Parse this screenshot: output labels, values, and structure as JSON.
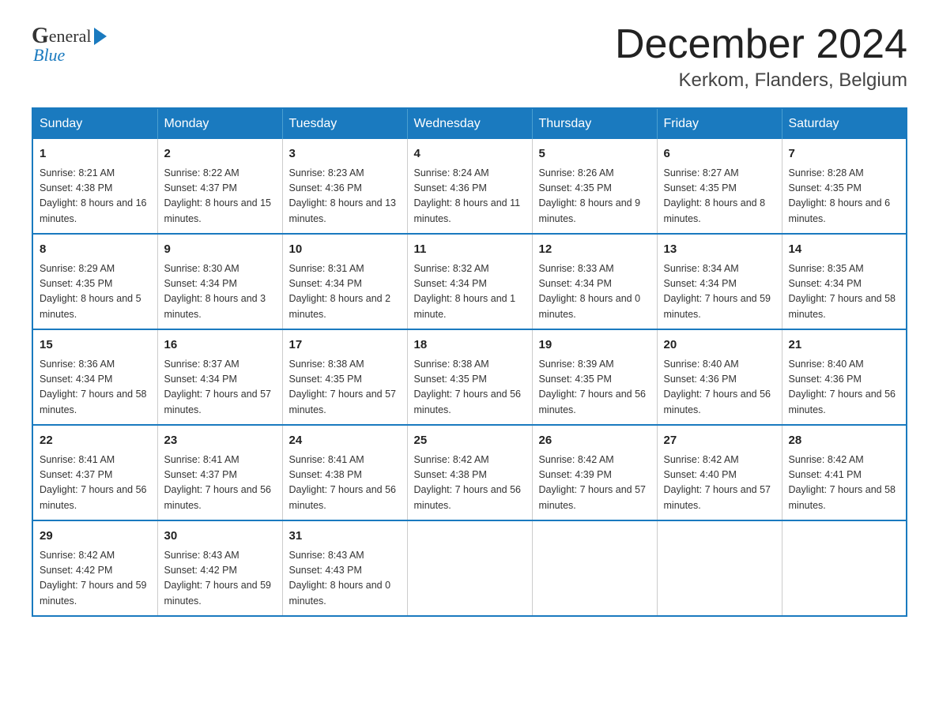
{
  "header": {
    "logo_general": "General",
    "logo_blue": "Blue",
    "month_title": "December 2024",
    "location": "Kerkom, Flanders, Belgium"
  },
  "days_of_week": [
    "Sunday",
    "Monday",
    "Tuesday",
    "Wednesday",
    "Thursday",
    "Friday",
    "Saturday"
  ],
  "weeks": [
    [
      {
        "day": "1",
        "sunrise": "Sunrise: 8:21 AM",
        "sunset": "Sunset: 4:38 PM",
        "daylight": "Daylight: 8 hours and 16 minutes."
      },
      {
        "day": "2",
        "sunrise": "Sunrise: 8:22 AM",
        "sunset": "Sunset: 4:37 PM",
        "daylight": "Daylight: 8 hours and 15 minutes."
      },
      {
        "day": "3",
        "sunrise": "Sunrise: 8:23 AM",
        "sunset": "Sunset: 4:36 PM",
        "daylight": "Daylight: 8 hours and 13 minutes."
      },
      {
        "day": "4",
        "sunrise": "Sunrise: 8:24 AM",
        "sunset": "Sunset: 4:36 PM",
        "daylight": "Daylight: 8 hours and 11 minutes."
      },
      {
        "day": "5",
        "sunrise": "Sunrise: 8:26 AM",
        "sunset": "Sunset: 4:35 PM",
        "daylight": "Daylight: 8 hours and 9 minutes."
      },
      {
        "day": "6",
        "sunrise": "Sunrise: 8:27 AM",
        "sunset": "Sunset: 4:35 PM",
        "daylight": "Daylight: 8 hours and 8 minutes."
      },
      {
        "day": "7",
        "sunrise": "Sunrise: 8:28 AM",
        "sunset": "Sunset: 4:35 PM",
        "daylight": "Daylight: 8 hours and 6 minutes."
      }
    ],
    [
      {
        "day": "8",
        "sunrise": "Sunrise: 8:29 AM",
        "sunset": "Sunset: 4:35 PM",
        "daylight": "Daylight: 8 hours and 5 minutes."
      },
      {
        "day": "9",
        "sunrise": "Sunrise: 8:30 AM",
        "sunset": "Sunset: 4:34 PM",
        "daylight": "Daylight: 8 hours and 3 minutes."
      },
      {
        "day": "10",
        "sunrise": "Sunrise: 8:31 AM",
        "sunset": "Sunset: 4:34 PM",
        "daylight": "Daylight: 8 hours and 2 minutes."
      },
      {
        "day": "11",
        "sunrise": "Sunrise: 8:32 AM",
        "sunset": "Sunset: 4:34 PM",
        "daylight": "Daylight: 8 hours and 1 minute."
      },
      {
        "day": "12",
        "sunrise": "Sunrise: 8:33 AM",
        "sunset": "Sunset: 4:34 PM",
        "daylight": "Daylight: 8 hours and 0 minutes."
      },
      {
        "day": "13",
        "sunrise": "Sunrise: 8:34 AM",
        "sunset": "Sunset: 4:34 PM",
        "daylight": "Daylight: 7 hours and 59 minutes."
      },
      {
        "day": "14",
        "sunrise": "Sunrise: 8:35 AM",
        "sunset": "Sunset: 4:34 PM",
        "daylight": "Daylight: 7 hours and 58 minutes."
      }
    ],
    [
      {
        "day": "15",
        "sunrise": "Sunrise: 8:36 AM",
        "sunset": "Sunset: 4:34 PM",
        "daylight": "Daylight: 7 hours and 58 minutes."
      },
      {
        "day": "16",
        "sunrise": "Sunrise: 8:37 AM",
        "sunset": "Sunset: 4:34 PM",
        "daylight": "Daylight: 7 hours and 57 minutes."
      },
      {
        "day": "17",
        "sunrise": "Sunrise: 8:38 AM",
        "sunset": "Sunset: 4:35 PM",
        "daylight": "Daylight: 7 hours and 57 minutes."
      },
      {
        "day": "18",
        "sunrise": "Sunrise: 8:38 AM",
        "sunset": "Sunset: 4:35 PM",
        "daylight": "Daylight: 7 hours and 56 minutes."
      },
      {
        "day": "19",
        "sunrise": "Sunrise: 8:39 AM",
        "sunset": "Sunset: 4:35 PM",
        "daylight": "Daylight: 7 hours and 56 minutes."
      },
      {
        "day": "20",
        "sunrise": "Sunrise: 8:40 AM",
        "sunset": "Sunset: 4:36 PM",
        "daylight": "Daylight: 7 hours and 56 minutes."
      },
      {
        "day": "21",
        "sunrise": "Sunrise: 8:40 AM",
        "sunset": "Sunset: 4:36 PM",
        "daylight": "Daylight: 7 hours and 56 minutes."
      }
    ],
    [
      {
        "day": "22",
        "sunrise": "Sunrise: 8:41 AM",
        "sunset": "Sunset: 4:37 PM",
        "daylight": "Daylight: 7 hours and 56 minutes."
      },
      {
        "day": "23",
        "sunrise": "Sunrise: 8:41 AM",
        "sunset": "Sunset: 4:37 PM",
        "daylight": "Daylight: 7 hours and 56 minutes."
      },
      {
        "day": "24",
        "sunrise": "Sunrise: 8:41 AM",
        "sunset": "Sunset: 4:38 PM",
        "daylight": "Daylight: 7 hours and 56 minutes."
      },
      {
        "day": "25",
        "sunrise": "Sunrise: 8:42 AM",
        "sunset": "Sunset: 4:38 PM",
        "daylight": "Daylight: 7 hours and 56 minutes."
      },
      {
        "day": "26",
        "sunrise": "Sunrise: 8:42 AM",
        "sunset": "Sunset: 4:39 PM",
        "daylight": "Daylight: 7 hours and 57 minutes."
      },
      {
        "day": "27",
        "sunrise": "Sunrise: 8:42 AM",
        "sunset": "Sunset: 4:40 PM",
        "daylight": "Daylight: 7 hours and 57 minutes."
      },
      {
        "day": "28",
        "sunrise": "Sunrise: 8:42 AM",
        "sunset": "Sunset: 4:41 PM",
        "daylight": "Daylight: 7 hours and 58 minutes."
      }
    ],
    [
      {
        "day": "29",
        "sunrise": "Sunrise: 8:42 AM",
        "sunset": "Sunset: 4:42 PM",
        "daylight": "Daylight: 7 hours and 59 minutes."
      },
      {
        "day": "30",
        "sunrise": "Sunrise: 8:43 AM",
        "sunset": "Sunset: 4:42 PM",
        "daylight": "Daylight: 7 hours and 59 minutes."
      },
      {
        "day": "31",
        "sunrise": "Sunrise: 8:43 AM",
        "sunset": "Sunset: 4:43 PM",
        "daylight": "Daylight: 8 hours and 0 minutes."
      },
      null,
      null,
      null,
      null
    ]
  ]
}
